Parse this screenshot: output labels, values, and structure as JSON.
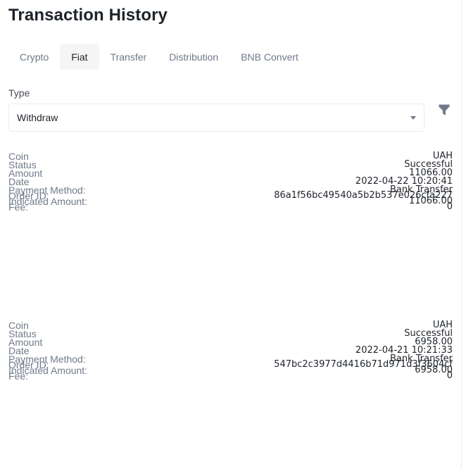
{
  "title": "Transaction History",
  "tabs": [
    {
      "label": "Crypto",
      "active": false
    },
    {
      "label": "Fiat",
      "active": true
    },
    {
      "label": "Transfer",
      "active": false
    },
    {
      "label": "Distribution",
      "active": false
    },
    {
      "label": "BNB Convert",
      "active": false
    }
  ],
  "filter": {
    "type_label": "Type",
    "type_value": "Withdraw",
    "filter_icon": "funnel-icon"
  },
  "field_labels": {
    "coin": "Coin",
    "status": "Status",
    "amount": "Amount",
    "date": "Date",
    "payment_method": "Payment Method:",
    "order_id": "Order ID:",
    "indicated_amount": "Indicated Amount:",
    "fee": "Fee:"
  },
  "records": [
    {
      "coin": "UAH",
      "status": "Successful",
      "amount": "11066.00",
      "date": "2022-04-22 10:20:41",
      "payment_method": "Bank Transfer",
      "order_id": "86a1f56bc49540a5b2b537e026cfa227",
      "indicated_amount": "11066.00",
      "fee": "0"
    },
    {
      "coin": "UAH",
      "status": "Successful",
      "amount": "6958.00",
      "date": "2022-04-21 10:21:33",
      "payment_method": "Bank Transfer",
      "order_id": "547bc2c3977d4416b71d971d3f3604cf",
      "indicated_amount": "6958.00",
      "fee": "0"
    }
  ],
  "colors": {
    "text_primary": "#1e2329",
    "text_secondary": "#707a8a",
    "border": "#eaecef",
    "tab_active_bg": "#f5f5f5"
  }
}
